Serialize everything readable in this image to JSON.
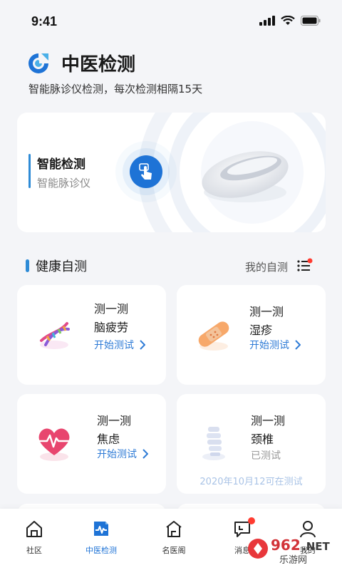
{
  "status": {
    "time": "9:41"
  },
  "header": {
    "title": "中医检测",
    "subtitle": "智能脉诊仪检测，每次检测相隔15天"
  },
  "hero": {
    "title": "智能检测",
    "subtitle": "智能脉诊仪"
  },
  "section": {
    "title": "健康自测",
    "my_tests": "我的自测"
  },
  "cards": [
    {
      "line1": "测一测",
      "line2": "脑疲劳",
      "action": "开始测试",
      "icon": "dna-icon"
    },
    {
      "line1": "测一测",
      "line2": "湿疹",
      "action": "开始测试",
      "icon": "bandage-icon"
    },
    {
      "line1": "测一测",
      "line2": "焦虑",
      "action": "开始测试",
      "icon": "heart-pulse-icon"
    },
    {
      "line1": "测一测",
      "line2": "颈椎",
      "action": "已测试",
      "note": "2020年10月12可在测试",
      "icon": "spine-icon"
    }
  ],
  "tabs": [
    {
      "label": "社区",
      "icon": "home-icon"
    },
    {
      "label": "中医检测",
      "icon": "pulse-doc-icon",
      "active": true
    },
    {
      "label": "名医阁",
      "icon": "building-icon"
    },
    {
      "label": "消息",
      "icon": "message-icon"
    },
    {
      "label": "我的",
      "icon": "person-icon"
    }
  ],
  "watermark": {
    "text": "962.NET",
    "sub": "乐游网"
  },
  "colors": {
    "accent": "#1e73d6",
    "badge": "#ff3b30"
  }
}
